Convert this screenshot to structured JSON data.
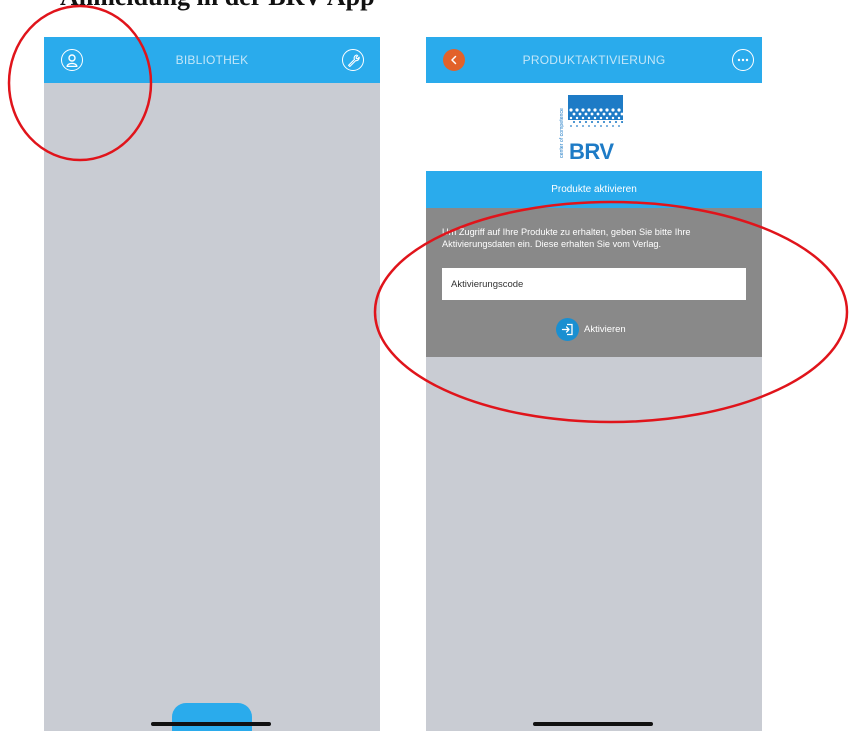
{
  "page": {
    "heading": "Anmeldung in der BRV App"
  },
  "left_screen": {
    "title": "BIBLIOTHEK",
    "account_icon": "user-circle-icon",
    "settings_icon": "wrench-icon"
  },
  "right_screen": {
    "title": "PRODUKTAKTIVIERUNG",
    "back_icon": "chevron-left-icon",
    "more_icon": "more-dots-icon",
    "logo": {
      "tagline": "center of competence",
      "name": "BRV"
    },
    "section_header": "Produkte aktivieren",
    "description": "Um Zugriff auf Ihre Produkte zu erhalten, geben Sie bitte Ihre Aktivierungsdaten ein. Diese erhalten Sie vom Verlag.",
    "code_placeholder": "Aktivierungscode",
    "activate_label": "Aktivieren"
  },
  "colors": {
    "nav_blue": "#2aabec",
    "panel_gray": "#898989",
    "screen_gray": "#c9ccd3",
    "back_orange": "#e2622a",
    "annotation_red": "#e0141b"
  }
}
